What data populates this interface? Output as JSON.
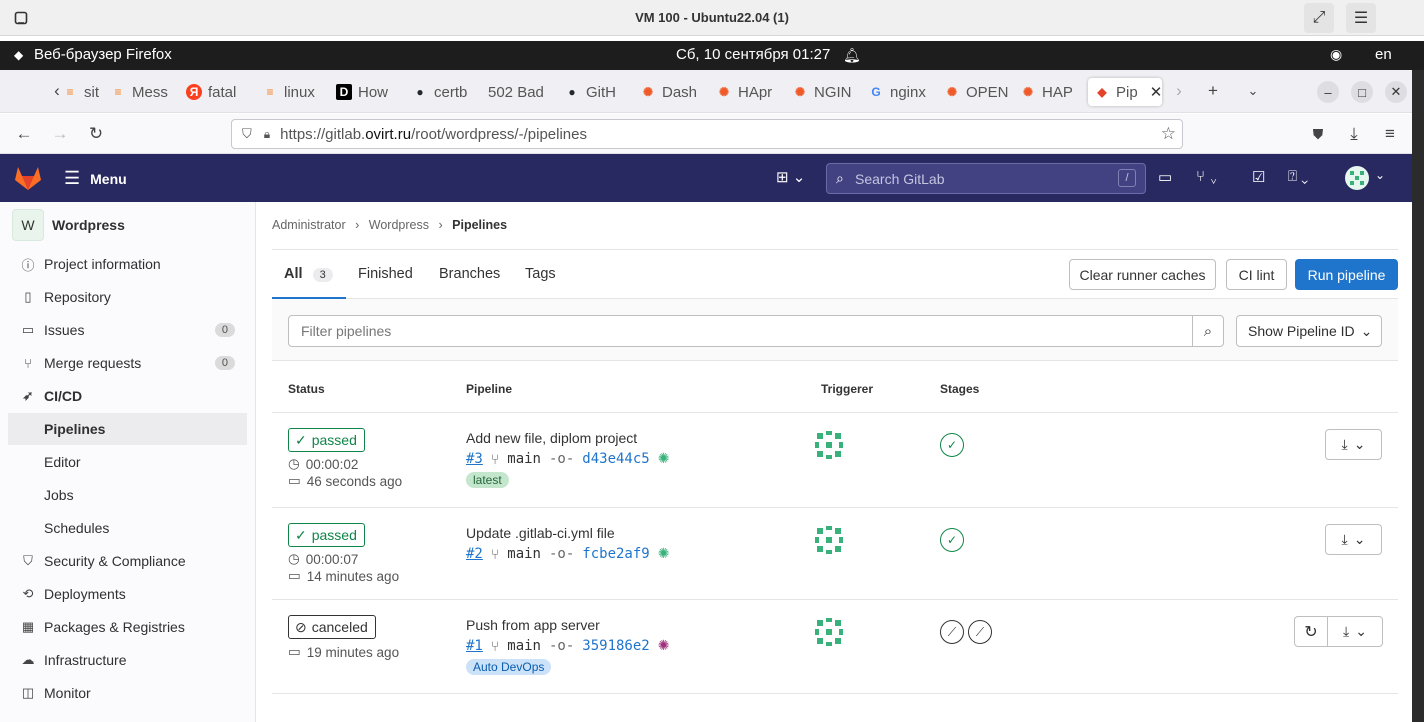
{
  "vm": {
    "title": "VM 100 - Ubuntu22.04 (1)"
  },
  "gnome": {
    "app": "Веб-браузер Firefox",
    "clock": "Сб, 10 сентября  01:27",
    "lang": "en"
  },
  "tabs": [
    {
      "label": "sit",
      "icon": "stackoverflow-icon",
      "color": "#f48024"
    },
    {
      "label": "Mess",
      "icon": "stackoverflow-icon",
      "color": "#f48024"
    },
    {
      "label": "fatal",
      "icon": "yandex-icon",
      "color": "#fc3f1d"
    },
    {
      "label": "linux",
      "icon": "stackoverflow-icon",
      "color": "#f48024"
    },
    {
      "label": "How",
      "icon": "dev-icon",
      "color": "#000000"
    },
    {
      "label": "certb",
      "icon": "github-icon",
      "color": "#24292f"
    },
    {
      "label": "502 Bad",
      "icon": "",
      "color": ""
    },
    {
      "label": "GitH",
      "icon": "github-icon",
      "color": "#24292f"
    },
    {
      "label": "Dash",
      "icon": "grafana-icon",
      "color": "#f05a28"
    },
    {
      "label": "HApr",
      "icon": "grafana-icon",
      "color": "#f05a28"
    },
    {
      "label": "NGIN",
      "icon": "grafana-icon",
      "color": "#f05a28"
    },
    {
      "label": "nginx",
      "icon": "google-icon",
      "color": "#4285f4"
    },
    {
      "label": "OPEN",
      "icon": "grafana-icon",
      "color": "#f05a28"
    },
    {
      "label": "HAP",
      "icon": "grafana-icon",
      "color": "#f05a28"
    },
    {
      "label": "Pip",
      "icon": "gitlab-icon",
      "color": "#e24329",
      "active": true
    }
  ],
  "url": {
    "prefix": "https://gitlab.",
    "domain": "ovirt.ru",
    "path": "/root/wordpress/-/pipelines"
  },
  "gitlab": {
    "menu_label": "Menu",
    "search_placeholder": "Search GitLab",
    "search_shortcut": "/"
  },
  "project": {
    "avatar_letter": "W",
    "name": "Wordpress"
  },
  "sidebar": [
    {
      "label": "Project information",
      "icon": "info-icon"
    },
    {
      "label": "Repository",
      "icon": "book-icon"
    },
    {
      "label": "Issues",
      "icon": "issues-icon",
      "badge": "0"
    },
    {
      "label": "Merge requests",
      "icon": "merge-request-icon",
      "badge": "0"
    },
    {
      "label": "CI/CD",
      "icon": "rocket-icon",
      "section": true
    },
    {
      "label": "Pipelines",
      "active": true
    },
    {
      "label": "Editor"
    },
    {
      "label": "Jobs"
    },
    {
      "label": "Schedules"
    },
    {
      "label": "Security & Compliance",
      "icon": "shield-icon"
    },
    {
      "label": "Deployments",
      "icon": "deployments-icon"
    },
    {
      "label": "Packages & Registries",
      "icon": "package-icon"
    },
    {
      "label": "Infrastructure",
      "icon": "cloud-icon"
    },
    {
      "label": "Monitor",
      "icon": "monitor-icon"
    }
  ],
  "breadcrumb": [
    "Administrator",
    "Wordpress",
    "Pipelines"
  ],
  "pipeline_tabs": {
    "all": "All",
    "all_count": "3",
    "finished": "Finished",
    "branches": "Branches",
    "tags": "Tags"
  },
  "actions": {
    "clear": "Clear runner caches",
    "lint": "CI lint",
    "run": "Run pipeline"
  },
  "filter": {
    "placeholder": "Filter pipelines",
    "show_id": "Show Pipeline ID"
  },
  "columns": {
    "status": "Status",
    "pipeline": "Pipeline",
    "triggerer": "Triggerer",
    "stages": "Stages"
  },
  "pipelines": [
    {
      "status": "passed",
      "duration": "00:00:02",
      "ago": "46 seconds ago",
      "title": "Add new file, diplom project",
      "id": "#3",
      "branch": "main",
      "commit": "d43e44c5",
      "tag": "latest",
      "stages": [
        "passed"
      ]
    },
    {
      "status": "passed",
      "duration": "00:00:07",
      "ago": "14 minutes ago",
      "title": "Update .gitlab-ci.yml file",
      "id": "#2",
      "branch": "main",
      "commit": "fcbe2af9",
      "tag": "",
      "stages": [
        "passed"
      ]
    },
    {
      "status": "canceled",
      "duration": "",
      "ago": "19 minutes ago",
      "title": "Push from app server",
      "id": "#1",
      "branch": "main",
      "commit": "359186e2",
      "tag": "Auto DevOps",
      "stages": [
        "canceled",
        "canceled"
      ]
    }
  ]
}
